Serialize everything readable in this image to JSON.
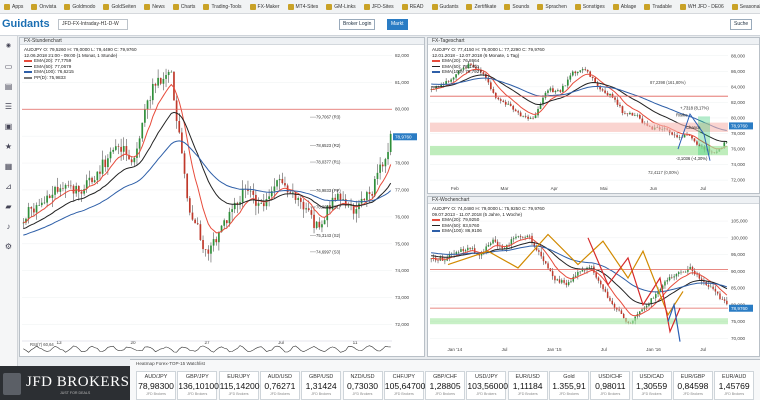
{
  "bookmarks": [
    "Apps",
    "Onvista",
    "Goldmodo",
    "GoldSeiten",
    "News",
    "Charts",
    "Trading-Tools",
    "FX-Maker",
    "MT4-Sites",
    "GM-Links",
    "JFD-Sites",
    "READ",
    "Gudants",
    "Zertifikate",
    "Sounds",
    "Sprachen",
    "Sonstiges",
    "Ablage",
    "Tradable",
    "WH JFD - DE06",
    "SeasonalBull",
    "JFD - YouTube",
    "Medien - investme"
  ],
  "app": {
    "logo": "Guidants",
    "tab_title": "JFD-FX-Intraday-H1-D-W",
    "btn_login": "Broker Login",
    "btn_market": "Markt",
    "btn_search": "Suche"
  },
  "chart_data": [
    {
      "type": "candlestick",
      "title": "FX-Stundenchart",
      "legend": [
        "AUDJPY   O: 79,5260  H: 79,0000  L: 79,4490  C: 79,9760",
        "12.06.2018 21:00 - 09:00 (1 Monat, 1 Stunde)"
      ],
      "indicators": [
        {
          "name": "EMA(20)",
          "value": "77,7759",
          "color": "#e74c3c"
        },
        {
          "name": "EMA(50)",
          "value": "77,0679",
          "color": "#222222"
        },
        {
          "name": "EMA(100)",
          "value": "76,6215",
          "color": "#2e5fa8"
        },
        {
          "name": "PP(D)",
          "value": "75,9833",
          "color": "#777777"
        }
      ],
      "y_ticks": [
        "82,000",
        "81,000",
        "80,000",
        "79,000",
        "78,000",
        "77,000",
        "76,000",
        "75,000",
        "74,000",
        "73,000",
        "72,000"
      ],
      "ylim": [
        71.5,
        82.2
      ],
      "x_ticks": [
        "13",
        "20",
        "27",
        "Jul",
        "11"
      ],
      "levels": [
        {
          "label": "79,7067 (R3)",
          "value": 79.7067
        },
        {
          "label": "78,6523 (R2)",
          "value": 78.6523
        },
        {
          "label": "78,0377 (R1)",
          "value": 78.0377
        },
        {
          "label": "76,9833 (PP)",
          "value": 76.9833
        },
        {
          "label": "76,3697 (S1)",
          "value": 76.3697
        },
        {
          "label": "75,3143 (S2)",
          "value": 75.3143
        },
        {
          "label": "74,6997 (S3)",
          "value": 74.6997
        }
      ],
      "current": "78,9760",
      "rsi_label": "RSI(7) 60,64"
    },
    {
      "type": "candlestick",
      "title": "FX-Tageschart",
      "legend": [
        "AUDJPY   O: 77,4150  H: 79,0000  L: 77,2290  C: 79,9760",
        "12.01.2018 - 12.07.2018 (6 Monate, 1 Tag)"
      ],
      "indicators": [
        {
          "name": "EMA(20)",
          "value": "76,8664",
          "color": "#e74c3c"
        },
        {
          "name": "EMA(50)",
          "value": "78,1401",
          "color": "#222222"
        },
        {
          "name": "EMA(100)",
          "value": "79,7927",
          "color": "#2e5fa8"
        }
      ],
      "y_ticks": [
        "88,000",
        "86,000",
        "84,000",
        "82,000",
        "80,000",
        "78,000",
        "76,000",
        "74,000",
        "72,000"
      ],
      "ylim": [
        71.5,
        89
      ],
      "x_ticks": [
        "Feb",
        "Mar",
        "Apr",
        "Mai",
        "Jun",
        "Jul"
      ],
      "annotations": [
        "87,2398 (161,80%)",
        "+,7318 (8,17%)",
        "Risiko",
        "Chance",
        "-3,1036 (-4,30%)",
        "72,4117 (0,00%)"
      ],
      "current": "78,9760"
    },
    {
      "type": "candlestick",
      "title": "FX-Wochenchart",
      "legend": [
        "AUDJPY   O: 74,0480  H: 79,0000  L: 75,9250  C: 79,9760",
        "09.07.2013 - 11.07.2018 (5 Jahre, 1 Woche)"
      ],
      "indicators": [
        {
          "name": "EMA(20)",
          "value": "79,9250",
          "color": "#e74c3c"
        },
        {
          "name": "EMA(50)",
          "value": "83,5760",
          "color": "#222222"
        },
        {
          "name": "EMA(100)",
          "value": "86,9106",
          "color": "#2e5fa8"
        }
      ],
      "y_ticks": [
        "105,000",
        "100,000",
        "95,000",
        "90,000",
        "85,000",
        "80,000",
        "75,000",
        "70,000"
      ],
      "ylim": [
        68,
        108
      ],
      "x_ticks": [
        "Jan '14",
        "Jul",
        "Jan '15",
        "Jul",
        "Jan '16",
        "Jul"
      ],
      "current": "78,9760"
    }
  ],
  "watchlist": {
    "title": "Heatmap  Forex-TOP-15  Watchlist",
    "items": [
      {
        "sym": "AUD/JPY",
        "price": "78,98300"
      },
      {
        "sym": "GBP/JPY",
        "price": "136,10100"
      },
      {
        "sym": "EUR/JPY",
        "price": "115,14200"
      },
      {
        "sym": "AUD/USD",
        "price": "0,76271"
      },
      {
        "sym": "GBP/USD",
        "price": "1,31424"
      },
      {
        "sym": "NZD/USD",
        "price": "0,73030"
      },
      {
        "sym": "CHF/JPY",
        "price": "105,64700"
      },
      {
        "sym": "GBP/CHF",
        "price": "1,28805"
      },
      {
        "sym": "USD/JPY",
        "price": "103,56000"
      },
      {
        "sym": "EUR/USD",
        "price": "1,11184"
      },
      {
        "sym": "Gold",
        "price": "1.355,91"
      },
      {
        "sym": "USD/CHF",
        "price": "0,98011"
      },
      {
        "sym": "USD/CAD",
        "price": "1,30559"
      },
      {
        "sym": "EUR/GBP",
        "price": "0,84598"
      },
      {
        "sym": "EUR/AUD",
        "price": "1,45769"
      }
    ],
    "broker_line": "JFD Brokers"
  },
  "broker": {
    "name": "JFD BROKERS",
    "tagline": "JUST FOR DEALS"
  }
}
